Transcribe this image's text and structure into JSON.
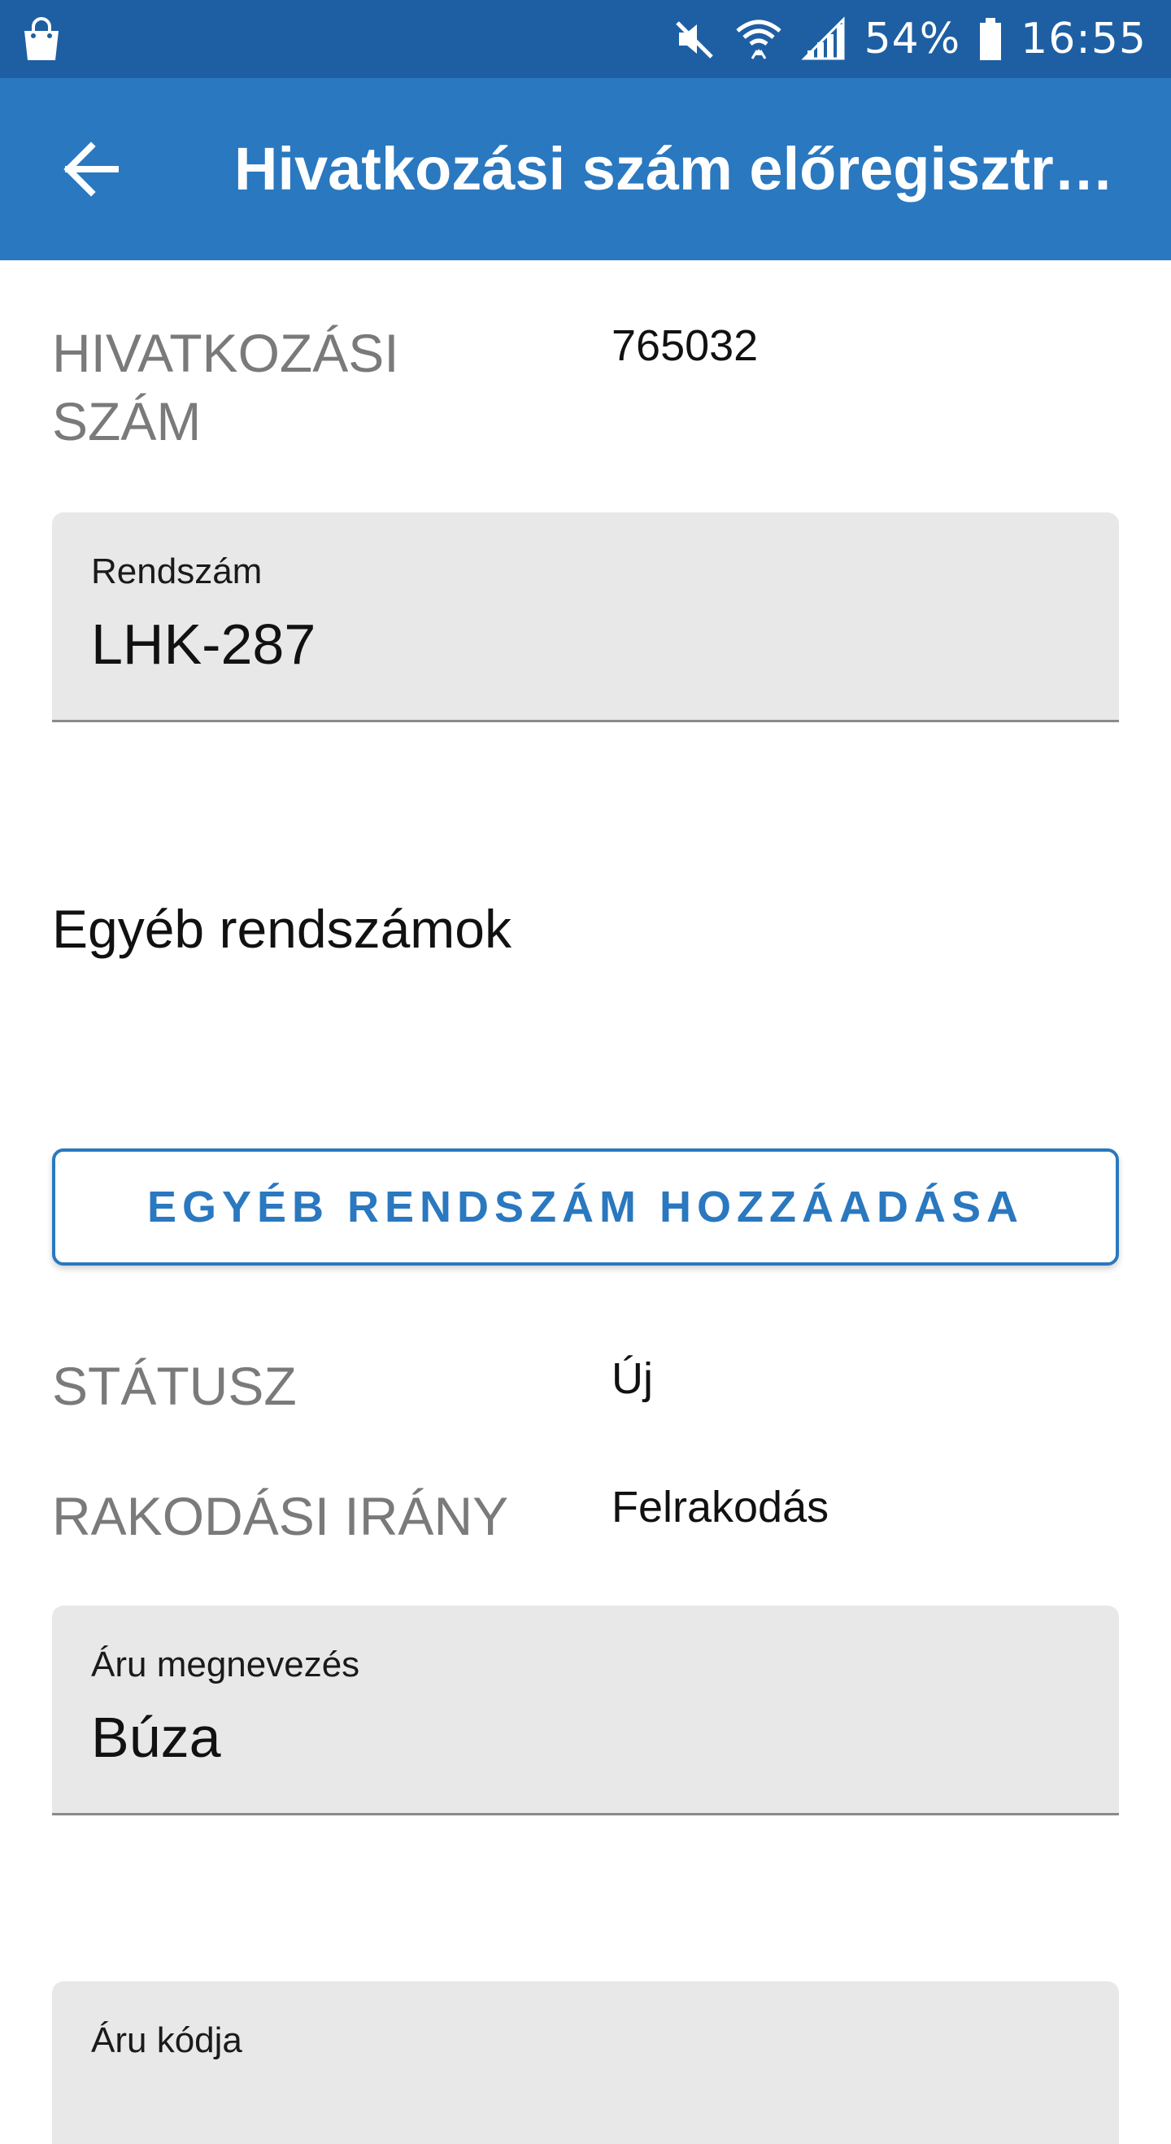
{
  "status_bar": {
    "battery": "54%",
    "time": "16:55",
    "icons": [
      "shopping-bag-icon",
      "mute-icon",
      "wifi-icon",
      "signal-icon",
      "battery-icon"
    ]
  },
  "app_bar": {
    "title": "Hivatkozási szám előregisztr…",
    "back_icon": "arrow-back-icon"
  },
  "reference": {
    "label_line1": "HIVATKOZÁSI",
    "label_line2": "SZÁM",
    "value": "765032"
  },
  "plate_field": {
    "label": "Rendszám",
    "value": "LHK-287"
  },
  "other_plates": {
    "heading": "Egyéb rendszámok",
    "add_button": "EGYÉB RENDSZÁM HOZZÁADÁSA"
  },
  "status": {
    "label": "STÁTUSZ",
    "value": "Új"
  },
  "loading_direction": {
    "label": "RAKODÁSI IRÁNY",
    "value": "Felrakodás"
  },
  "goods_name_field": {
    "label": "Áru megnevezés",
    "value": "Búza"
  },
  "goods_code_field": {
    "label": "Áru kódja",
    "value": ""
  },
  "colors": {
    "status_bar": "#1e5fa3",
    "app_bar": "#2a78bf",
    "accent": "#2a78bf",
    "field_bg": "#e8e8e8",
    "label_gray": "#7a7a7a"
  }
}
